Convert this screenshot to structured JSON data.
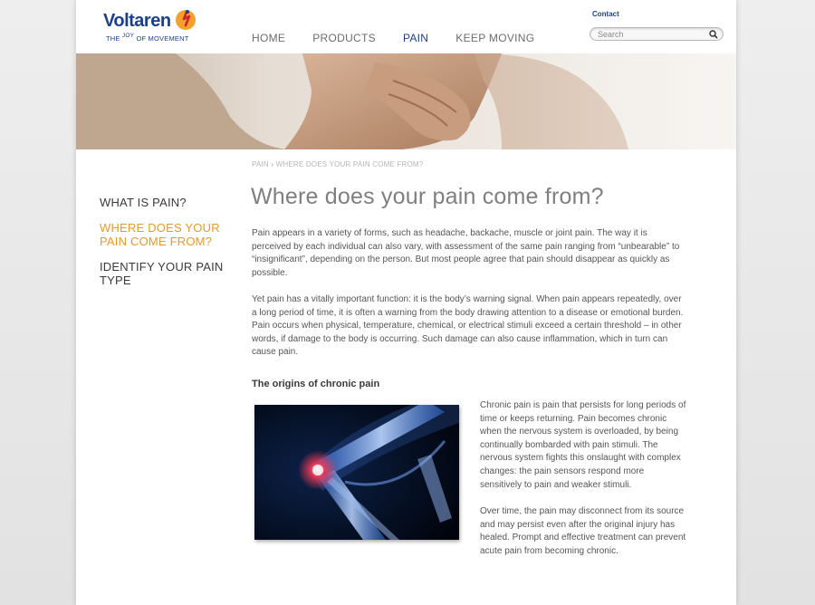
{
  "brand": {
    "name": "Voltaren",
    "tagline_pre": "THE",
    "tagline_sup": "JOY",
    "tagline_post": "OF MOVEMENT",
    "primary_color": "#1c3f8c",
    "accent_color": "#e39a2d"
  },
  "header": {
    "nav": [
      {
        "label": "HOME",
        "active": false
      },
      {
        "label": "PRODUCTS",
        "active": false
      },
      {
        "label": "PAIN",
        "active": true
      },
      {
        "label": "KEEP MOVING",
        "active": false
      }
    ],
    "contact_label": "Contact",
    "search": {
      "placeholder": "Search",
      "value": "",
      "icon": "search-icon"
    }
  },
  "sidebar": {
    "items": [
      {
        "label": "WHAT IS PAIN?",
        "active": false
      },
      {
        "label": "WHERE DOES YOUR PAIN COME FROM?",
        "active": true
      },
      {
        "label": "IDENTIFY YOUR PAIN TYPE",
        "active": false
      }
    ]
  },
  "breadcrumb": {
    "items": [
      "PAIN",
      "WHERE DOES YOUR PAIN COME FROM?"
    ],
    "separator": "›"
  },
  "main": {
    "title": "Where does your pain come from?",
    "paragraphs": [
      "Pain appears in a variety of forms, such as headache, backache, muscle or joint pain. The way it is perceived by each individual can also vary, with assessment of the same pain ranging from “unbearable” to “insignificant”, depending on the person. But most people agree that pain should disappear as quickly as possible.",
      "Yet pain has a vitally important function: it is the body’s warning signal. When pain appears repeatedly, over a long period of time, it is often a warning from the body drawing attention to a disease or emotional burden. Pain occurs when physical, temperature, chemical, or electrical stimuli exceed a certain threshold – in other words, if damage to the body is occurring. Such damage can also cause inflammation, which in turn can cause pain."
    ],
    "section": {
      "heading": "The origins of chronic pain",
      "paragraphs": [
        "Chronic pain is pain that persists for long periods of time or keeps returning. Pain becomes chronic when the nervous system is overloaded, by being continually bombarded with pain stimuli. The nervous system fights this onslaught with complex changes: the pain sensors respond more sensitively to pain and weaker stimuli.",
        "Over time, the pain may disconnect from its source and may persist even after the original injury has healed. Prompt and effective treatment can prevent acute pain from becoming chronic."
      ]
    }
  }
}
